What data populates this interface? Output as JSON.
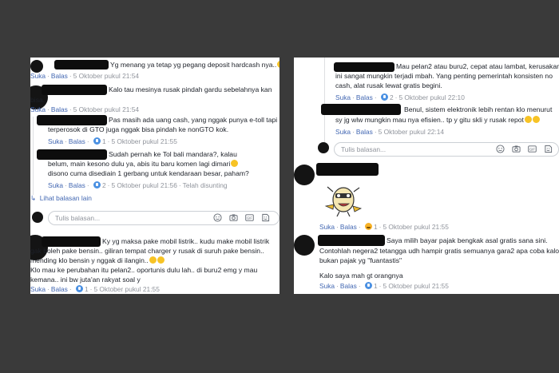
{
  "common": {
    "like": "Suka",
    "reply": "Balas",
    "sep": "·",
    "reply_placeholder": "Tulis balasan...",
    "gif": "GIF"
  },
  "left": {
    "comments": [
      {
        "lines": [
          "Yg menang ya tetap yg pegang deposit hardcash nya.."
        ],
        "time": "5 Oktober pukul 21:54"
      },
      {
        "lines": [
          "Kalo tau mesinya rusak pindah gardu sebelahnya kan",
          "bisa."
        ],
        "time": "5 Oktober pukul 21:54"
      },
      {
        "lines": [
          "Pas masih ada uang cash, yang nggak punya e-toll tapi",
          "terperosok di GTO juga nggak bisa pindah ke nonGTO kok."
        ],
        "count": "1",
        "time": "5 Oktober pukul 21:55"
      },
      {
        "lines": [
          "Sudah pernah ke Tol bali mandara?, kalau",
          "belum, main kesono dulu ya, abis itu baru komen lagi dimari",
          "disono cuma disediain 1 gerbang untuk kendaraan besar, paham?"
        ],
        "count": "2",
        "time": "5 Oktober pukul 21:56",
        "edited": "Telah disunting"
      },
      {
        "lines": [
          "Ky yg maksa pake mobil listrik.. kudu make mobil listrik",
          "gak boleh pake bensin.. giliran tempat charger y rusak di suruh pake bensin..",
          "mending klo bensin y nggak di ilangin..",
          "Klo mau ke perubahan itu pelan2.. oportunis dulu lah.. di buru2 emg y mau",
          "kemana.. ini bw juta'an rakyat soal y"
        ],
        "count": "1",
        "time": "5 Oktober pukul 21:55"
      }
    ],
    "more_replies": "Lihat balasan lain"
  },
  "right": {
    "comments": [
      {
        "lines": [
          "Mau pelan2 atau buru2, cepat atau lambat, kerusakan spt",
          "ini sangat mungkin terjadi mbah. Yang penting pemerintah konsisten no",
          "cash, alat rusak lewat gratis begini."
        ],
        "count": "2",
        "time": "5 Oktober pukul 22:10"
      },
      {
        "lines": [
          "Benul, sistem elektronik lebih rentan klo menurut",
          "sy jg wlw mungkin mau nya efisien.. tp y gitu skli y rusak repot"
        ],
        "time": "5 Oktober pukul 22:14"
      },
      {
        "lines": [],
        "count": "1",
        "time": "5 Oktober pukul 21:55"
      },
      {
        "lines": [
          "Saya milih bayar pajak bengkak asal gratis sana sini.",
          "Contohlah negera2 tetangga udh hampir gratis semuanya gara2 apa coba kalo",
          "bukan pajak yg \"fuantastis\"",
          "",
          "Kalo saya mah gt orangnya"
        ],
        "count": "1",
        "time": "5 Oktober pukul 21:55"
      }
    ]
  },
  "icons": [
    "emoji-icon",
    "camera-icon",
    "gif-icon",
    "sticker-icon"
  ],
  "colors": {
    "link": "#4267b2",
    "meta": "#90949c",
    "text": "#1d2129",
    "background": "#3a3a3a"
  }
}
